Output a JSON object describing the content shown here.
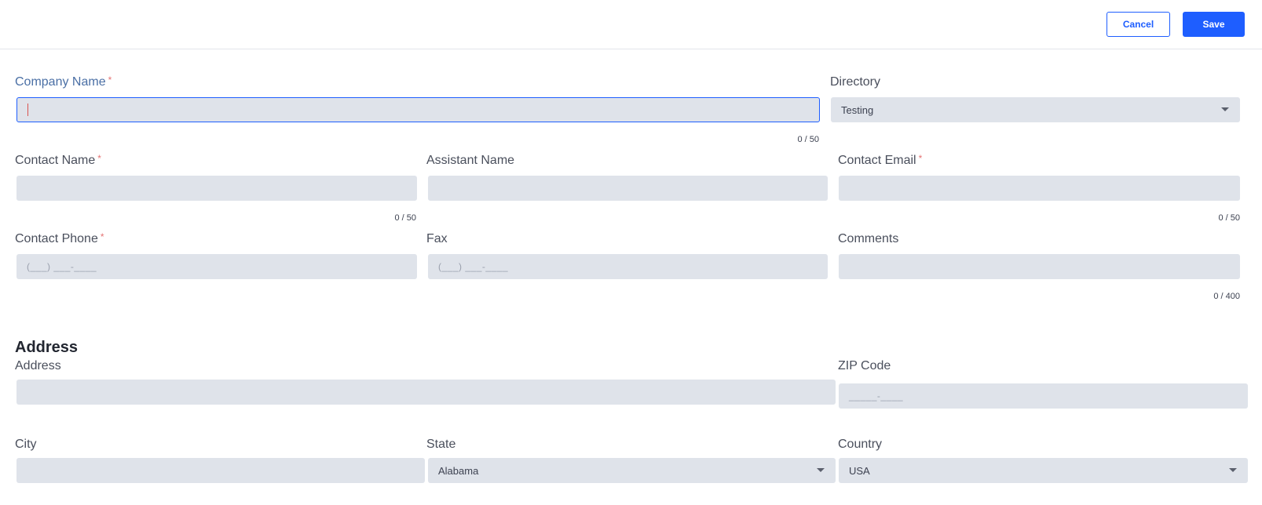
{
  "toolbar": {
    "cancel_label": "Cancel",
    "save_label": "Save"
  },
  "form": {
    "company_name": {
      "label": "Company Name",
      "required": "*",
      "value": "",
      "counter": "0 / 50"
    },
    "directory": {
      "label": "Directory",
      "value": "Testing"
    },
    "contact_name": {
      "label": "Contact Name",
      "required": "*",
      "value": "",
      "counter": "0 / 50"
    },
    "assistant_name": {
      "label": "Assistant Name",
      "value": ""
    },
    "contact_email": {
      "label": "Contact Email",
      "required": "*",
      "value": "",
      "counter": "0 / 50"
    },
    "contact_phone": {
      "label": "Contact Phone",
      "required": "*",
      "placeholder": "(___) ___-____"
    },
    "fax": {
      "label": "Fax",
      "placeholder": "(___) ___-____"
    },
    "comments": {
      "label": "Comments",
      "value": "",
      "counter": "0 / 400"
    }
  },
  "address_section": {
    "title": "Address",
    "address": {
      "label": "Address",
      "value": ""
    },
    "zip": {
      "label": "ZIP Code",
      "placeholder": "_____-____"
    },
    "city": {
      "label": "City",
      "value": ""
    },
    "state": {
      "label": "State",
      "value": "Alabama"
    },
    "country": {
      "label": "Country",
      "value": "USA"
    }
  },
  "colors": {
    "accent": "#1e5eff",
    "field_bg": "#dfe3ea",
    "required": "#e57373"
  },
  "icons": {
    "dropdown": "chevron-down-icon"
  }
}
